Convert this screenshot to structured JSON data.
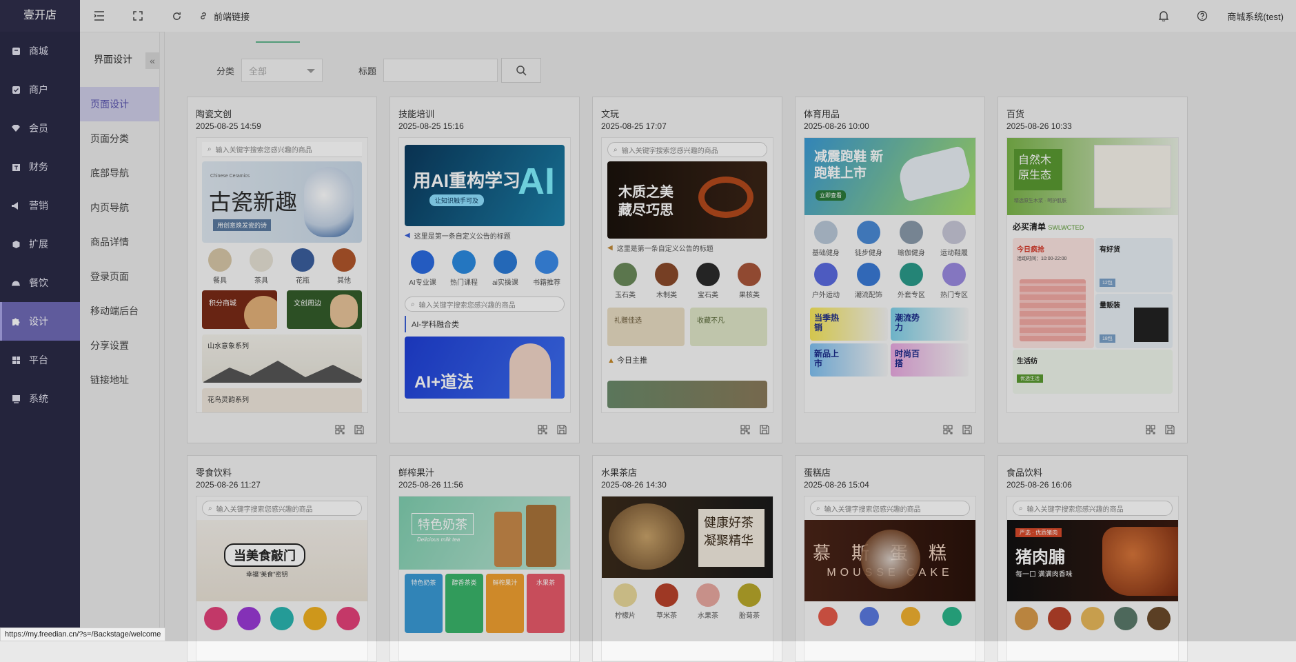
{
  "brand": "壹开店",
  "nav": [
    {
      "label": "商城",
      "icon": "shop-icon"
    },
    {
      "label": "商户",
      "icon": "merchant-icon"
    },
    {
      "label": "会员",
      "icon": "member-icon"
    },
    {
      "label": "财务",
      "icon": "finance-icon"
    },
    {
      "label": "营销",
      "icon": "megaphone-icon"
    },
    {
      "label": "扩展",
      "icon": "cube-icon"
    },
    {
      "label": "餐饮",
      "icon": "dining-icon"
    },
    {
      "label": "设计",
      "icon": "puzzle-icon",
      "active": true
    },
    {
      "label": "平台",
      "icon": "grid-icon"
    },
    {
      "label": "系统",
      "icon": "system-icon"
    }
  ],
  "subnav": {
    "title": "界面设计",
    "items": [
      "页面设计",
      "页面分类",
      "底部导航",
      "内页导航",
      "商品详情",
      "登录页面",
      "移动端后台",
      "分享设置",
      "链接地址"
    ]
  },
  "topbar": {
    "link_label": "前端链接",
    "user": "商城系统(test)"
  },
  "filter": {
    "category_label": "分类",
    "category_value": "全部",
    "title_label": "标题"
  },
  "preview_common": {
    "search_placeholder": "输入关键字搜索您感兴趣的商品",
    "notice": "这里是第一条自定义公告的标题"
  },
  "cards": [
    {
      "title": "陶瓷文创",
      "date": "2025-08-25 14:59",
      "banner_small": "Chinese Ceramics",
      "banner": "古瓷新趣",
      "banner_sub": "用创意焕发瓷的诗",
      "icons": [
        "餐具",
        "茶具",
        "花瓶",
        "其他"
      ],
      "tiles": [
        "积分商城",
        "文创周边"
      ],
      "strip1": "山水意象系列",
      "strip2": "花鸟灵韵系列"
    },
    {
      "title": "技能培训",
      "date": "2025-08-25 15:16",
      "banner": "用AI重构学习",
      "banner_sub": "让知识触手可及",
      "icons": [
        "AI专业课",
        "热门课程",
        "ai实操课",
        "书籍推荐"
      ],
      "section": "AI-学科融合类",
      "banner2": "AI+道法"
    },
    {
      "title": "文玩",
      "date": "2025-08-25 17:07",
      "banner": "木质之美 藏尽巧思",
      "icons": [
        "玉石类",
        "木制类",
        "宝石类",
        "果核类"
      ],
      "tiles": [
        "礼赠佳选",
        "收藏不凡"
      ],
      "section": "今日主推"
    },
    {
      "title": "体育用品",
      "date": "2025-08-26 10:00",
      "banner": "减震跑鞋 新跑鞋上市",
      "banner_btn": "立即查看",
      "icons": [
        "基础健身",
        "徒步健身",
        "瑜伽健身",
        "运动鞋履",
        "户外运动",
        "潮流配饰",
        "外套专区",
        "热门专区"
      ],
      "tiles": [
        "当季热销",
        "潮流势力",
        "新品上市",
        "时尚百搭"
      ]
    },
    {
      "title": "百货",
      "date": "2025-08-26 10:33",
      "banner": "自然木原生态",
      "banner_sub": "精选原生木浆 · 呵护肌肤",
      "section": "必买清单",
      "section_tag": "SWLWCTED",
      "tile1_title": "今日疯抢",
      "tile1_sub": "活动时间：10:00-22:00",
      "tile2_title": "有好货",
      "tile2_tag": "12包",
      "tile3_title": "量贩装",
      "tile3_tag": "18包",
      "tile4_title": "生活纺",
      "tile4_btn": "优选生活"
    },
    {
      "title": "零食饮料",
      "date": "2025-08-26 11:27",
      "banner": "当美食敲门",
      "banner_sub": "幸福\"美食\"密钥"
    },
    {
      "title": "鲜榨果汁",
      "date": "2025-08-26 11:56",
      "banner": "特色奶茶",
      "banner_sub": "Delicious milk tea",
      "tiles": [
        "特色奶茶",
        "醇香茶类",
        "鲜榨果汁",
        "水果茶"
      ]
    },
    {
      "title": "水果茶店",
      "date": "2025-08-26 14:30",
      "banner": "健康好茶 凝聚精华",
      "icons": [
        "柠檬片",
        "草米茶",
        "水果茶",
        "胎菊茶"
      ]
    },
    {
      "title": "蛋糕店",
      "date": "2025-08-26 15:04",
      "banner": "慕斯蛋糕",
      "banner_en": "MOUSSE CAKE"
    },
    {
      "title": "食品饮料",
      "date": "2025-08-26 16:06",
      "banner": "猪肉脯",
      "banner_sub": "每一口 满满肉香味",
      "banner_tag": "严选 · 优质猪肉"
    }
  ],
  "status_url": "https://my.freedian.cn/?s=/Backstage/welcome"
}
